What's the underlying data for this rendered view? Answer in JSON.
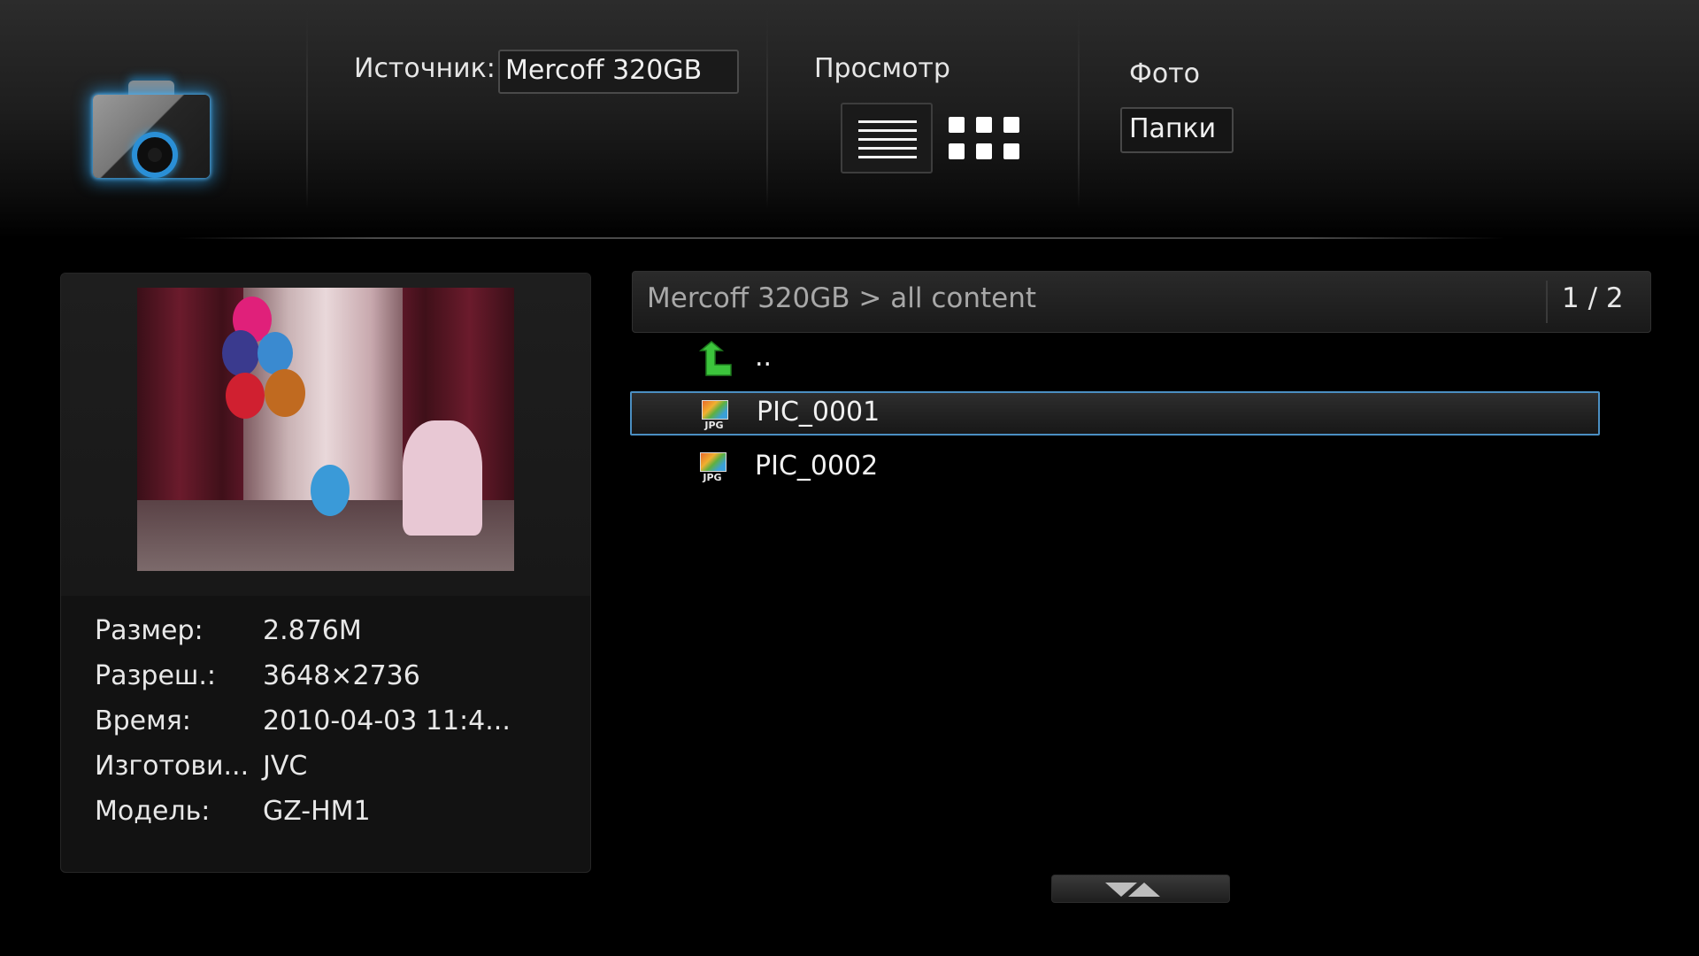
{
  "header": {
    "source_label": "Источник:",
    "source_value": "Mercoff 320GB",
    "view_label": "Просмотр",
    "photo_label": "Фото",
    "folders_button": "Папки"
  },
  "preview": {
    "details": [
      {
        "key": "Размер:",
        "value": "2.876M"
      },
      {
        "key": "Разреш.:",
        "value": "3648×2736"
      },
      {
        "key": "Время:",
        "value": "2010-04-03 11:4..."
      },
      {
        "key": "Изготови...",
        "value": "JVC"
      },
      {
        "key": "Модель:",
        "value": "GZ-HM1"
      }
    ]
  },
  "browser": {
    "path": "Mercoff 320GB > all content",
    "page": "1 / 2",
    "items": [
      {
        "name": "..",
        "icon": "folder-up-icon"
      },
      {
        "name": "PIC_0001",
        "icon": "jpg-file-icon",
        "selected": true
      },
      {
        "name": "PIC_0002",
        "icon": "jpg-file-icon"
      }
    ]
  },
  "colors": {
    "accent_glow": "#2a8fd6",
    "selection_border": "#4b8fc2",
    "up_arrow": "#3cc43c"
  }
}
